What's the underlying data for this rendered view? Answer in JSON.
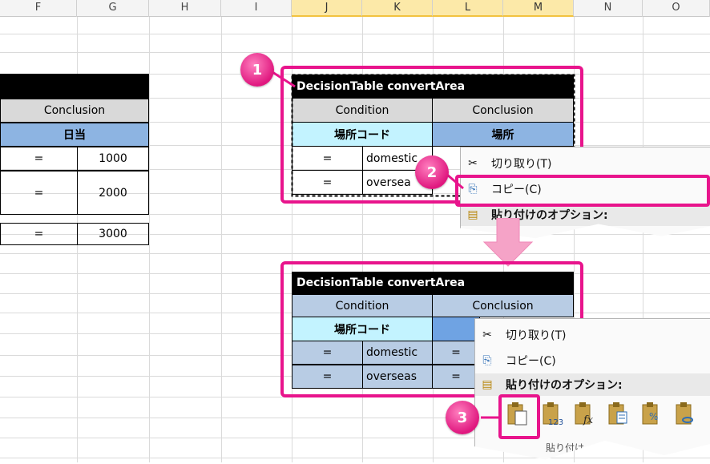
{
  "columns": [
    "F",
    "G",
    "H",
    "I",
    "J",
    "K",
    "L",
    "M",
    "N",
    "O"
  ],
  "left_table": {
    "header": "Conclusion",
    "subheader": "日当",
    "rows": [
      [
        "=",
        "1000"
      ],
      [
        "=",
        "2000"
      ],
      [
        "=",
        "3000"
      ]
    ]
  },
  "table": {
    "title": "DecisionTable convertArea",
    "condition_label": "Condition",
    "conclusion_label": "Conclusion",
    "condition_field": "場所コード",
    "conclusion_field": "場所",
    "rows": [
      {
        "op": "=",
        "value": "domestic"
      },
      {
        "op": "=",
        "value": "overseas"
      }
    ],
    "row1_partial": "domestic",
    "row2_partial": "oversea"
  },
  "menu_top": {
    "cut": "切り取り(T)",
    "copy": "コピー(C)",
    "paste_options": "貼り付けのオプション:"
  },
  "menu_bottom": {
    "cut": "切り取り(T)",
    "copy": "コピー(C)",
    "paste_options": "貼り付けのオプション:",
    "paste_special_partial": "貼り付け",
    "paste_values_sub": "123",
    "paste_formulas_sub": "fx"
  },
  "badges": [
    "1",
    "2",
    "3"
  ],
  "colors": {
    "accent": "#e8148c",
    "header_blue": "#8db4e2",
    "cyan": "#c3f3ff",
    "arrow": "#f5a3c7"
  }
}
